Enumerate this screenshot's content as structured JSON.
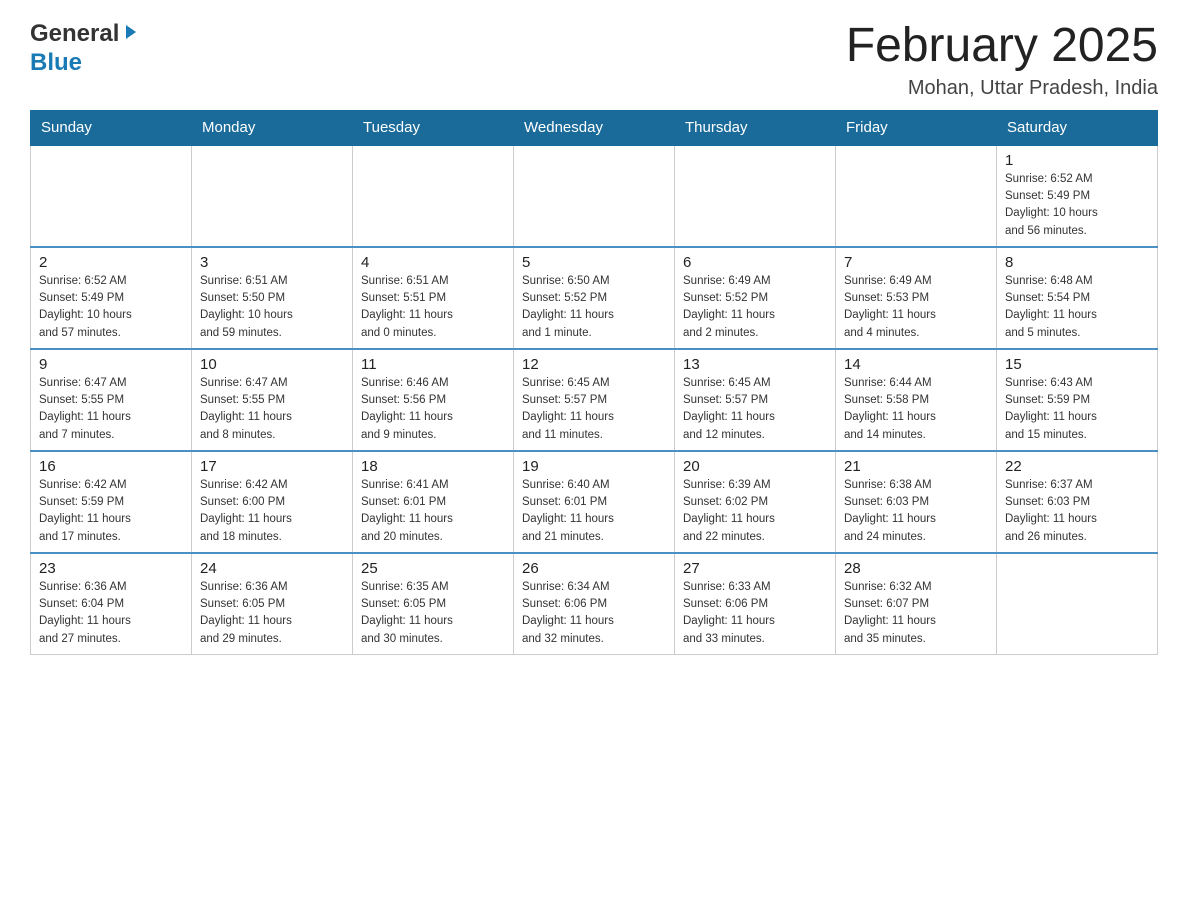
{
  "header": {
    "logo_general": "General",
    "logo_blue": "Blue",
    "title": "February 2025",
    "subtitle": "Mohan, Uttar Pradesh, India"
  },
  "weekdays": [
    "Sunday",
    "Monday",
    "Tuesday",
    "Wednesday",
    "Thursday",
    "Friday",
    "Saturday"
  ],
  "weeks": [
    [
      {
        "day": "",
        "info": ""
      },
      {
        "day": "",
        "info": ""
      },
      {
        "day": "",
        "info": ""
      },
      {
        "day": "",
        "info": ""
      },
      {
        "day": "",
        "info": ""
      },
      {
        "day": "",
        "info": ""
      },
      {
        "day": "1",
        "info": "Sunrise: 6:52 AM\nSunset: 5:49 PM\nDaylight: 10 hours\nand 56 minutes."
      }
    ],
    [
      {
        "day": "2",
        "info": "Sunrise: 6:52 AM\nSunset: 5:49 PM\nDaylight: 10 hours\nand 57 minutes."
      },
      {
        "day": "3",
        "info": "Sunrise: 6:51 AM\nSunset: 5:50 PM\nDaylight: 10 hours\nand 59 minutes."
      },
      {
        "day": "4",
        "info": "Sunrise: 6:51 AM\nSunset: 5:51 PM\nDaylight: 11 hours\nand 0 minutes."
      },
      {
        "day": "5",
        "info": "Sunrise: 6:50 AM\nSunset: 5:52 PM\nDaylight: 11 hours\nand 1 minute."
      },
      {
        "day": "6",
        "info": "Sunrise: 6:49 AM\nSunset: 5:52 PM\nDaylight: 11 hours\nand 2 minutes."
      },
      {
        "day": "7",
        "info": "Sunrise: 6:49 AM\nSunset: 5:53 PM\nDaylight: 11 hours\nand 4 minutes."
      },
      {
        "day": "8",
        "info": "Sunrise: 6:48 AM\nSunset: 5:54 PM\nDaylight: 11 hours\nand 5 minutes."
      }
    ],
    [
      {
        "day": "9",
        "info": "Sunrise: 6:47 AM\nSunset: 5:55 PM\nDaylight: 11 hours\nand 7 minutes."
      },
      {
        "day": "10",
        "info": "Sunrise: 6:47 AM\nSunset: 5:55 PM\nDaylight: 11 hours\nand 8 minutes."
      },
      {
        "day": "11",
        "info": "Sunrise: 6:46 AM\nSunset: 5:56 PM\nDaylight: 11 hours\nand 9 minutes."
      },
      {
        "day": "12",
        "info": "Sunrise: 6:45 AM\nSunset: 5:57 PM\nDaylight: 11 hours\nand 11 minutes."
      },
      {
        "day": "13",
        "info": "Sunrise: 6:45 AM\nSunset: 5:57 PM\nDaylight: 11 hours\nand 12 minutes."
      },
      {
        "day": "14",
        "info": "Sunrise: 6:44 AM\nSunset: 5:58 PM\nDaylight: 11 hours\nand 14 minutes."
      },
      {
        "day": "15",
        "info": "Sunrise: 6:43 AM\nSunset: 5:59 PM\nDaylight: 11 hours\nand 15 minutes."
      }
    ],
    [
      {
        "day": "16",
        "info": "Sunrise: 6:42 AM\nSunset: 5:59 PM\nDaylight: 11 hours\nand 17 minutes."
      },
      {
        "day": "17",
        "info": "Sunrise: 6:42 AM\nSunset: 6:00 PM\nDaylight: 11 hours\nand 18 minutes."
      },
      {
        "day": "18",
        "info": "Sunrise: 6:41 AM\nSunset: 6:01 PM\nDaylight: 11 hours\nand 20 minutes."
      },
      {
        "day": "19",
        "info": "Sunrise: 6:40 AM\nSunset: 6:01 PM\nDaylight: 11 hours\nand 21 minutes."
      },
      {
        "day": "20",
        "info": "Sunrise: 6:39 AM\nSunset: 6:02 PM\nDaylight: 11 hours\nand 22 minutes."
      },
      {
        "day": "21",
        "info": "Sunrise: 6:38 AM\nSunset: 6:03 PM\nDaylight: 11 hours\nand 24 minutes."
      },
      {
        "day": "22",
        "info": "Sunrise: 6:37 AM\nSunset: 6:03 PM\nDaylight: 11 hours\nand 26 minutes."
      }
    ],
    [
      {
        "day": "23",
        "info": "Sunrise: 6:36 AM\nSunset: 6:04 PM\nDaylight: 11 hours\nand 27 minutes."
      },
      {
        "day": "24",
        "info": "Sunrise: 6:36 AM\nSunset: 6:05 PM\nDaylight: 11 hours\nand 29 minutes."
      },
      {
        "day": "25",
        "info": "Sunrise: 6:35 AM\nSunset: 6:05 PM\nDaylight: 11 hours\nand 30 minutes."
      },
      {
        "day": "26",
        "info": "Sunrise: 6:34 AM\nSunset: 6:06 PM\nDaylight: 11 hours\nand 32 minutes."
      },
      {
        "day": "27",
        "info": "Sunrise: 6:33 AM\nSunset: 6:06 PM\nDaylight: 11 hours\nand 33 minutes."
      },
      {
        "day": "28",
        "info": "Sunrise: 6:32 AM\nSunset: 6:07 PM\nDaylight: 11 hours\nand 35 minutes."
      },
      {
        "day": "",
        "info": ""
      }
    ]
  ]
}
